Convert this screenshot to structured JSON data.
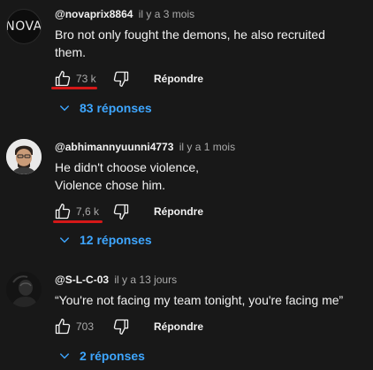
{
  "comments": [
    {
      "avatar_text": "NOVA",
      "author": "@novaprix8864",
      "time": "il y a 3 mois",
      "lines": [
        "Bro not only fought the demons, he also recruited",
        "them."
      ],
      "likes": "73 k",
      "reply_label": "Répondre",
      "replies_label": "83 réponses"
    },
    {
      "author": "@abhimannyuunni4773",
      "time": "il y a 1 mois",
      "lines": [
        "He didn't choose violence,",
        "Violence chose him."
      ],
      "likes": "7,6 k",
      "reply_label": "Répondre",
      "replies_label": "12 réponses"
    },
    {
      "author": "@S-L-C-03",
      "time": "il y a 13 jours",
      "lines": [
        "“You're not facing my team tonight, you're facing me”"
      ],
      "likes": "703",
      "reply_label": "Répondre",
      "replies_label": "2 réponses"
    }
  ],
  "colors": {
    "background": "#181818",
    "link": "#3ea6ff",
    "annotation": "#d41818"
  },
  "icons": [
    "thumb-up-icon",
    "thumb-down-icon",
    "chevron-down-icon"
  ]
}
